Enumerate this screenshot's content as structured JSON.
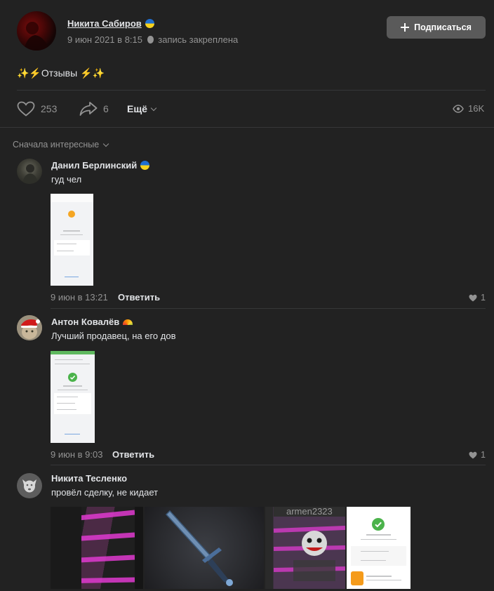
{
  "post": {
    "author": "Никита Сабиров",
    "date": "9 июн 2021 в 8:15",
    "pinned": "запись закреплена",
    "subscribe_label": "Подписаться",
    "text": "✨⚡Отзывы ⚡✨",
    "likes": "253",
    "shares": "6",
    "more_label": "Ещё",
    "views": "16K"
  },
  "sort_label": "Сначала интересные",
  "comments": [
    {
      "name": "Данил Берлинский",
      "text": "гуд чел",
      "date": "9 июн в 13:21",
      "reply": "Ответить",
      "likes": "1"
    },
    {
      "name": "Антон Ковалёв",
      "text": "Лучший продавец, на его дов",
      "date": "9 июн в 9:03",
      "reply": "Ответить",
      "likes": "1"
    },
    {
      "name": "Никита Тесленко",
      "text": "провёл сделку, не кидает"
    }
  ],
  "colors": {
    "background": "#222222",
    "text": "#e1e3e6",
    "muted": "#939393",
    "button": "#5a5a5a",
    "success": "#4bb34b"
  }
}
